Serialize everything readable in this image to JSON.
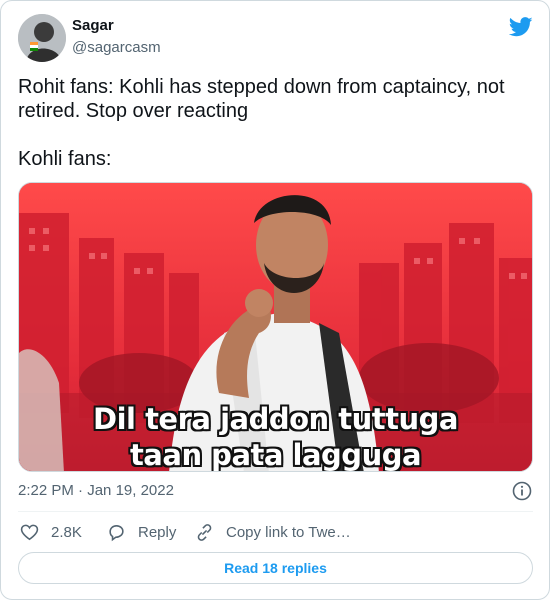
{
  "author": {
    "name": "Sagar",
    "handle": "@sagarcasm"
  },
  "tweet": {
    "line1": "Rohit fans: Kohli has stepped down from captaincy, not retired. Stop over reacting",
    "line2": "Kohli fans:"
  },
  "media": {
    "subtitle_line1": "Dil tera jaddon tuttuga",
    "subtitle_line2": "taan pata lagguga"
  },
  "meta": {
    "time": "2:22 PM",
    "separator": " · ",
    "date": "Jan 19, 2022"
  },
  "actions": {
    "likes": "2.8K",
    "reply": "Reply",
    "copy": "Copy link to Twe…"
  },
  "read_replies": "Read 18 replies",
  "colors": {
    "brand": "#1d9bf0",
    "text": "#0f1419",
    "secondary": "#536471",
    "border": "#cfd9de"
  },
  "icons": [
    "twitter-bird-icon",
    "info-icon",
    "heart-icon",
    "reply-bubble-icon",
    "link-icon"
  ]
}
